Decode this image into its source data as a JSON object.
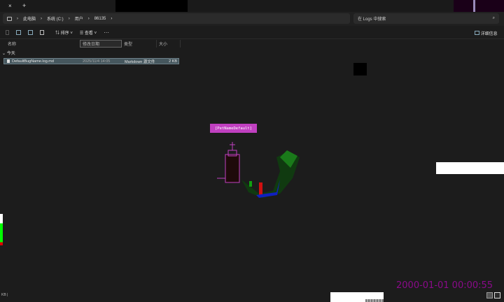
{
  "tabs": {
    "close": "×",
    "new": "+"
  },
  "breadcrumb": {
    "items": [
      "此电脑",
      "系统 (C:)",
      "用户",
      "86135"
    ],
    "sep": "›"
  },
  "search": {
    "placeholder": "在 Logs 中搜索",
    "icon": "search-icon"
  },
  "toolbar": {
    "sort": "排序",
    "view": "查看",
    "more": "···",
    "details": "详细信息"
  },
  "columns": [
    "名称",
    "修改日期",
    "类型",
    "大小"
  ],
  "group": {
    "label": "今天",
    "chevron": "⌄"
  },
  "files": [
    {
      "name": "DefaultBugName.log.md",
      "date": "2025/11/4 14:05",
      "type": "Markdown 源文件",
      "size": "2 KB"
    }
  ],
  "pet": {
    "label": "[PetNameDefault]"
  },
  "status": {
    "text": "KB |"
  },
  "overlay": {
    "timestamp": "2000-01-01 00:00:55",
    "color": "#8a0a8a"
  }
}
